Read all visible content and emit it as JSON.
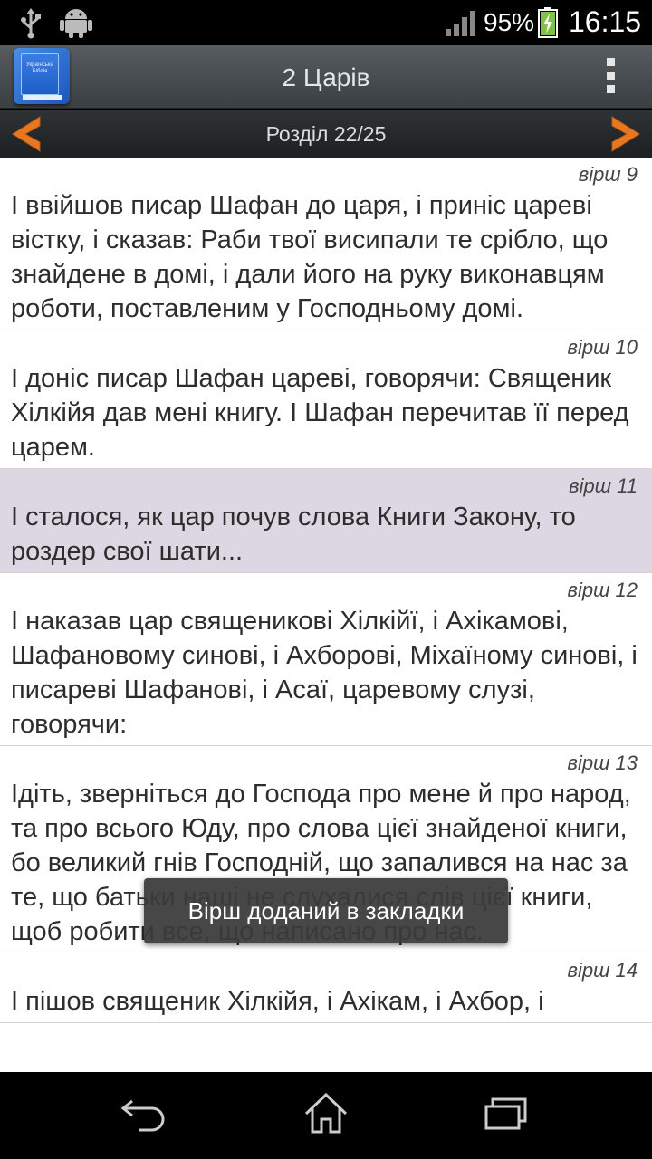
{
  "status_bar": {
    "battery_percent": "95%",
    "time": "16:15",
    "icons": [
      "usb-icon",
      "android-debug-icon",
      "signal-icon",
      "battery-charging-icon"
    ]
  },
  "action_bar": {
    "logo_text": "Українська Біблія",
    "title": "2 Царів",
    "menu_icon": "overflow-menu-icon"
  },
  "chapter_nav": {
    "label": "Розділ 22/25",
    "prev_icon": "chevron-left-icon",
    "next_icon": "chevron-right-icon",
    "accent_color": "#e87722"
  },
  "verses": [
    {
      "label": "вірш 9",
      "text": "І ввійшов писар Шафан до царя, і приніс цареві вістку, і сказав: Раби твої висипали те срібло, що знайдене в домі, і дали його на руку виконавцям роботи, поставленим у Господньому домі.",
      "highlighted": false
    },
    {
      "label": "вірш 10",
      "text": "І доніс писар Шафан цареві, говорячи: Священик Хілкійя дав мені книгу. І Шафан перечитав її перед царем.",
      "highlighted": false
    },
    {
      "label": "вірш 11",
      "text": "І сталося, як цар почув слова Книги Закону, то роздер свої шати...",
      "highlighted": true
    },
    {
      "label": "вірш 12",
      "text": "І наказав цар священикові Хілкійї, і Ахікамові, Шафановому синові, і Ахборові, Міхаїному синові, і писареві Шафанові, і Асаї, царевому слузі, говорячи:",
      "highlighted": false
    },
    {
      "label": "вірш 13",
      "text": "Ідіть, зверніться до Господа про мене й про народ, та про всього Юду, про слова цієї знайденої книги, бо великий гнів Господній, що запалився на нас за те, що батьки наші не слухалися слів цієї книги, щоб робити все, що написано про нас.",
      "highlighted": false
    },
    {
      "label": "вірш 14",
      "text": "І пішов священик Хілкійя, і Ахікам, і Ахбор, і",
      "highlighted": false
    }
  ],
  "toast": {
    "message": "Вірш доданий в закладки"
  },
  "nav_bar": {
    "icons": [
      "back-icon",
      "home-icon",
      "recents-icon"
    ]
  },
  "colors": {
    "highlight": "#ddd6e3",
    "accent": "#e87722"
  }
}
